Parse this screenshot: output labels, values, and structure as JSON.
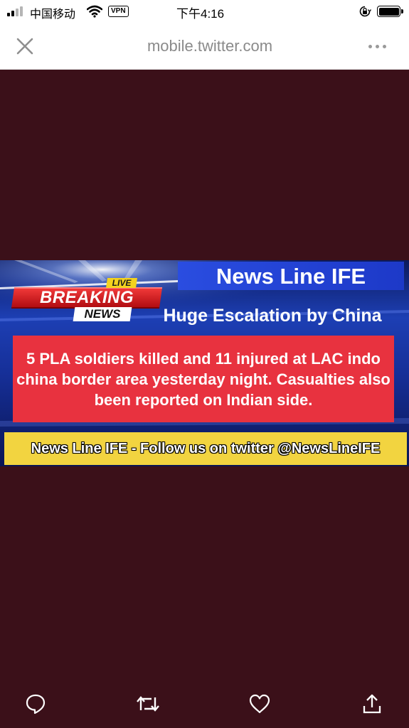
{
  "status_bar": {
    "carrier": "中国移动",
    "vpn": "VPN",
    "time": "下午4:16"
  },
  "browser": {
    "url": "mobile.twitter.com"
  },
  "media": {
    "title": "News Line IFE",
    "breaking_label": "BREAKING",
    "live_label": "LIVE",
    "news_label": "NEWS",
    "subtitle": "Huge Escalation by China",
    "headline": "5 PLA soldiers killed and 11 injured at LAC indo china border area yesterday night. Casualties also been reported on Indian side.",
    "ticker": "News Line IFE - Follow us on twitter @NewsLineIFE"
  },
  "colors": {
    "viewer_background": "#3b1019",
    "headline_box": "#e8323f",
    "ticker_band": "#f2d440",
    "title_bar": "#2a4de0"
  },
  "actions": [
    {
      "icon": "reply-icon"
    },
    {
      "icon": "retweet-icon"
    },
    {
      "icon": "like-icon"
    },
    {
      "icon": "share-icon"
    }
  ]
}
